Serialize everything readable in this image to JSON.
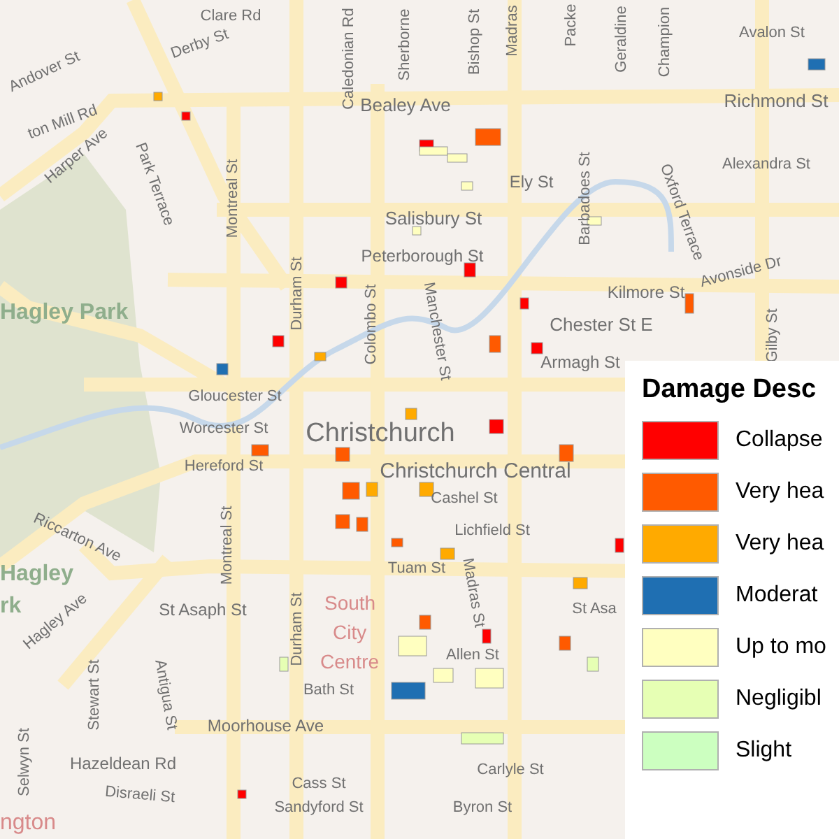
{
  "map": {
    "labels": [
      "Clare Rd",
      "Caledonian Rd",
      "Sherborne",
      "Bishop St",
      "Madras",
      "Packe",
      "Geraldine",
      "Champion",
      "Avalon St",
      "Derby St",
      "Andover St",
      "Richmond St",
      "Bealey Ave",
      "ton Mill Rd",
      "Harper Ave",
      "Alexandra St",
      "Ely St",
      "Park Terrace",
      "Montreal St",
      "Barbadoes St",
      "Oxford Terrace",
      "Salisbury St",
      "Peterborough St",
      "Avonside Dr",
      "Kilmore St",
      "Durham St",
      "Colombo St",
      "Manchester St",
      "Chester St E",
      "Gilby St",
      "Armagh St",
      "Gloucester St",
      "Worcester St",
      "Christchurch",
      "Hereford St",
      "Christchurch Central",
      "Cashel St",
      "Lichfield St",
      "Riccarton Ave",
      "Montreal St",
      "Tuam St",
      "Madras St",
      "St Asaph St",
      "St Asa",
      "Hagley Ave",
      "Allen St",
      "Durham St",
      "Stewart St",
      "Antigua St",
      "Bath St",
      "Moorhouse Ave",
      "Selwyn St",
      "Hazeldean Rd",
      "Carlyle St",
      "Cass St",
      "Disraeli St",
      "Sandyford St",
      "Byron St"
    ],
    "parks": [
      "Hagley Park",
      "Hagley",
      "rk"
    ],
    "places": [
      "South",
      "City",
      "Centre",
      "ngton"
    ]
  },
  "legend": {
    "title": "Damage Desc",
    "items": [
      {
        "label": "Collapse",
        "color": "#ff0000"
      },
      {
        "label": "Very hea",
        "color": "#ff5a00"
      },
      {
        "label": "Very hea",
        "color": "#ffaa00"
      },
      {
        "label": "Moderat",
        "color": "#1f6fb2"
      },
      {
        "label": "Up to mo",
        "color": "#ffffc0"
      },
      {
        "label": "Negligibl",
        "color": "#e6ffb4"
      },
      {
        "label": "Slight",
        "color": "#ccffc0"
      }
    ]
  }
}
